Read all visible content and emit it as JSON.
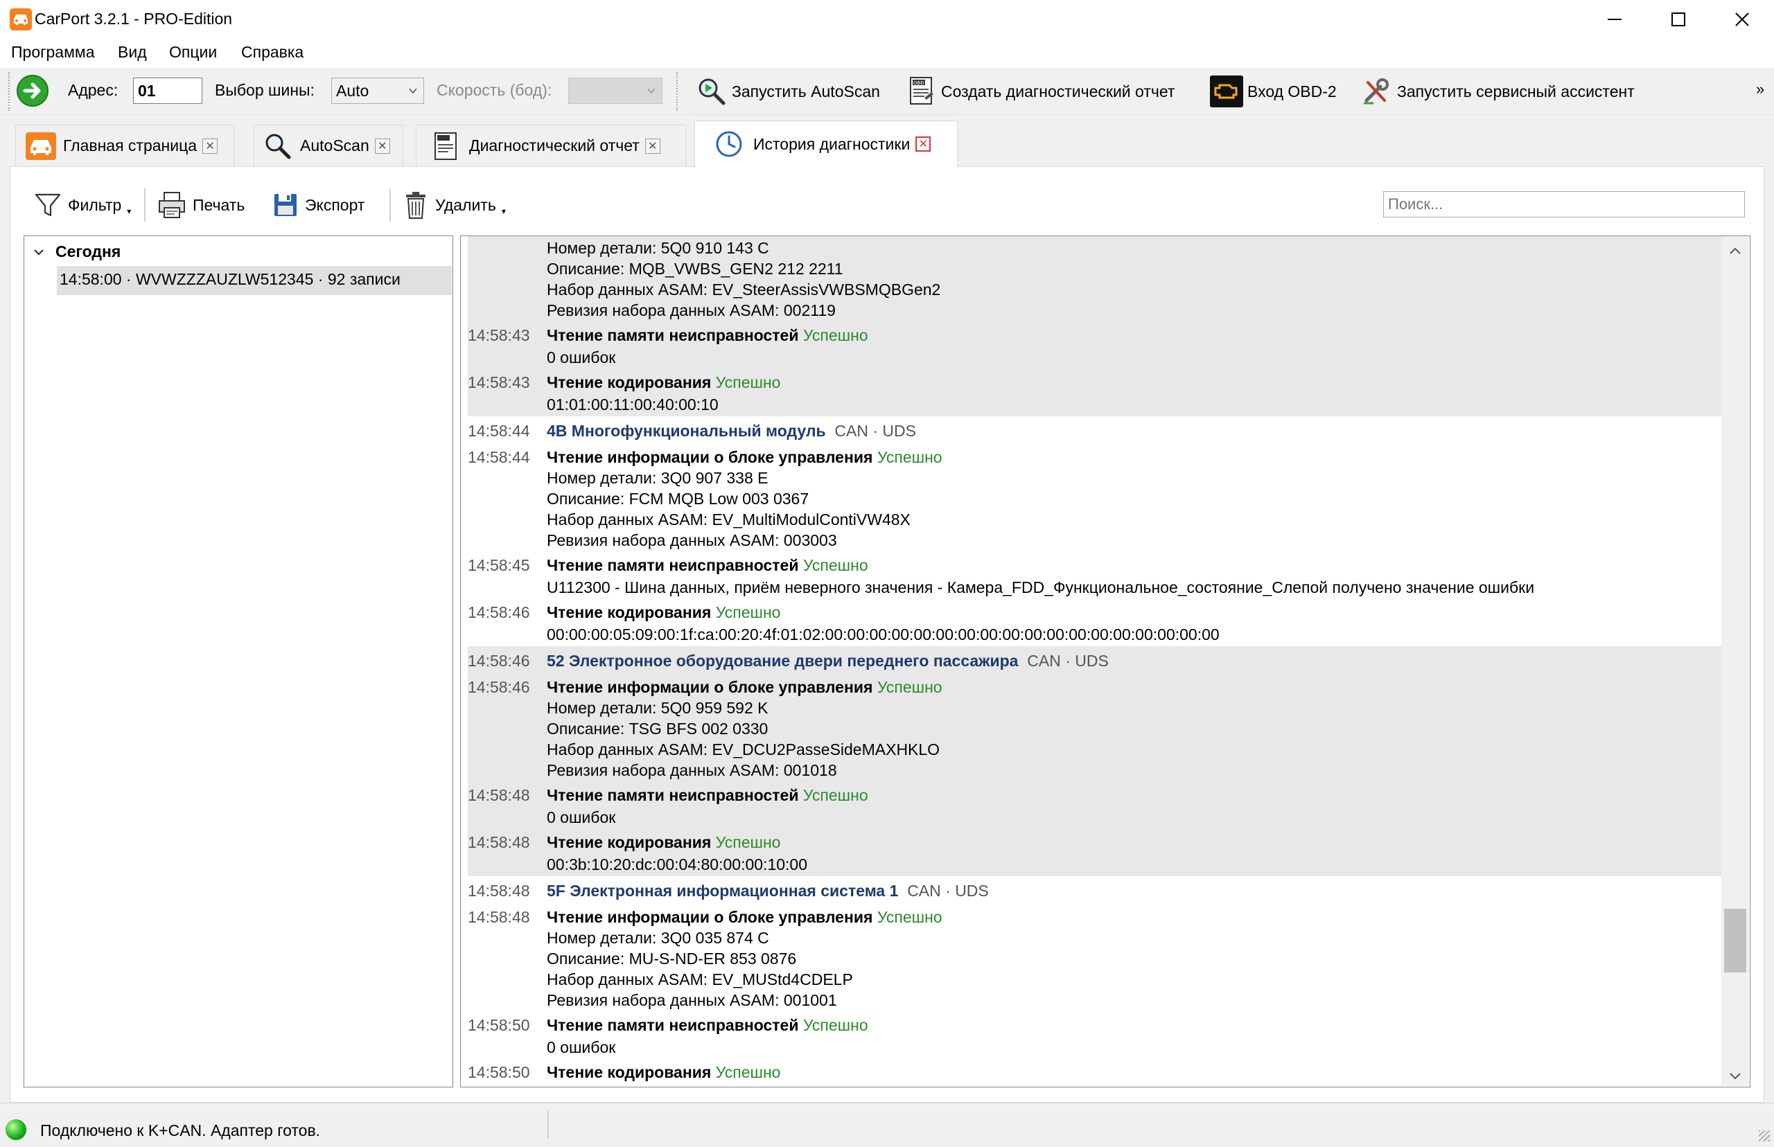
{
  "window": {
    "title": "CarPort 3.2.1 - PRO-Edition"
  },
  "menu": [
    "Программа",
    "Вид",
    "Опции",
    "Справка"
  ],
  "toolbar": {
    "address_label": "Адрес:",
    "address_value": "01",
    "bus_label": "Выбор шины:",
    "bus_value": "Auto",
    "speed_label": "Скорость (бод):",
    "speed_value": "",
    "autoscan": "Запустить AutoScan",
    "create_report": "Создать диагностический отчет",
    "obd2": "Вход OBD-2",
    "service_assistant": "Запустить сервисный ассистент",
    "overflow": "»"
  },
  "tabs": [
    {
      "label": "Главная страница",
      "icon": "car-icon"
    },
    {
      "label": "AutoScan",
      "icon": "magnifier-icon"
    },
    {
      "label": "Диагностический отчет",
      "icon": "report-icon"
    },
    {
      "label": "История диагностики",
      "icon": "clock-icon",
      "active": true
    }
  ],
  "actions": {
    "filter": "Фильтр",
    "print": "Печать",
    "export": "Экспорт",
    "delete": "Удалить",
    "search_placeholder": "Поиск..."
  },
  "tree": {
    "group": "Сегодня",
    "entry": "14:58:00 · WVWZZZAUZLW512345 · 92 записи"
  },
  "log": {
    "g1": {
      "l1": "Номер детали: 5Q0 910 143 C",
      "l2": "Описание: MQB_VWBS_GEN2 212 2211",
      "l3": "Набор данных ASAM: EV_SteerAssisVWBSMQBGen2",
      "l4": "Ревизия набора данных ASAM: 002119",
      "t5": "14:58:43",
      "h5": "Чтение памяти неисправностей",
      "s5": "Успешно",
      "l5": "0 ошибок",
      "t6": "14:58:43",
      "h6": "Чтение кодирования",
      "s6": "Успешно",
      "l6": "01:01:00:11:00:40:00:10"
    },
    "g2": {
      "t0": "14:58:44",
      "mod": "4B Многофункциональный модуль",
      "proto": "CAN · UDS",
      "t1": "14:58:44",
      "h1": "Чтение информации о блоке управления",
      "s1": "Успешно",
      "l1": "Номер детали: 3Q0 907 338 E",
      "l2": "Описание: FCM MQB Low 003 0367",
      "l3": "Набор данных ASAM: EV_MultiModulContiVW48X",
      "l4": "Ревизия набора данных ASAM: 003003",
      "t5": "14:58:45",
      "h5": "Чтение памяти неисправностей",
      "s5": "Успешно",
      "l5": "U112300 - Шина данных, приём неверного значения - Камера_FDD_Функциональное_состояние_Слепой получено значение ошибки",
      "t6": "14:58:46",
      "h6": "Чтение кодирования",
      "s6": "Успешно",
      "l6": "00:00:00:05:09:00:1f:ca:00:20:4f:01:02:00:00:00:00:00:00:00:00:00:00:00:00:00:00:00:00:00:00"
    },
    "g3": {
      "t0": "14:58:46",
      "mod": "52 Электронное оборудование двери переднего пассажира",
      "proto": "CAN · UDS",
      "t1": "14:58:46",
      "h1": "Чтение информации о блоке управления",
      "s1": "Успешно",
      "l1": "Номер детали: 5Q0 959 592 K",
      "l2": "Описание: TSG BFS 002 0330",
      "l3": "Набор данных ASAM: EV_DCU2PasseSideMAXHKLO",
      "l4": "Ревизия набора данных ASAM: 001018",
      "t5": "14:58:48",
      "h5": "Чтение памяти неисправностей",
      "s5": "Успешно",
      "l5": "0 ошибок",
      "t6": "14:58:48",
      "h6": "Чтение кодирования",
      "s6": "Успешно",
      "l6": "00:3b:10:20:dc:00:04:80:00:00:10:00"
    },
    "g4": {
      "t0": "14:58:48",
      "mod": "5F Электронная информационная система 1",
      "proto": "CAN · UDS",
      "t1": "14:58:48",
      "h1": "Чтение информации о блоке управления",
      "s1": "Успешно",
      "l1": "Номер детали: 3Q0 035 874 C",
      "l2": "Описание: MU-S-ND-ER 853 0876",
      "l3": "Набор данных ASAM: EV_MUStd4CDELP",
      "l4": "Ревизия набора данных ASAM: 001001",
      "t5": "14:58:50",
      "h5": "Чтение памяти неисправностей",
      "s5": "Успешно",
      "l5": "0 ошибок",
      "t6": "14:58:50",
      "h6": "Чтение кодирования",
      "s6": "Успешно"
    }
  },
  "status": {
    "text": "Подключено к K+CAN. Адаптер готов.",
    "led_color": "#19b21a"
  },
  "colors": {
    "accent": "#f58220",
    "success": "#2a8a2a",
    "module": "#1e3a6e"
  }
}
